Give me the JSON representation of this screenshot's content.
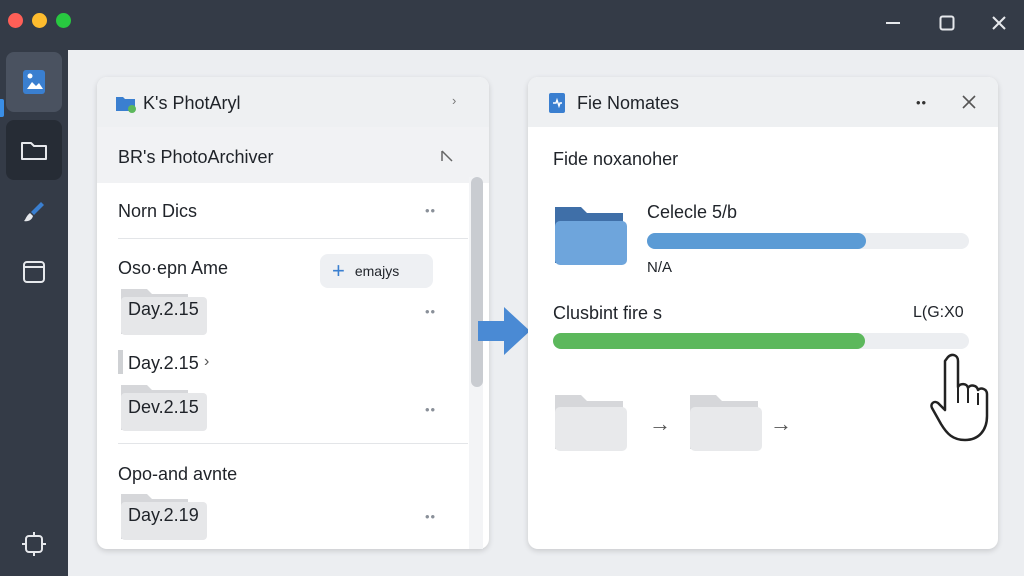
{
  "window": {
    "controls": [
      "close",
      "minimize",
      "zoom"
    ],
    "colors": {
      "close": "#ff5f57",
      "minimize": "#febc2e",
      "zoom": "#28c840"
    }
  },
  "sidebar": {
    "items": [
      {
        "icon": "photos-icon",
        "active": true
      },
      {
        "icon": "folder-icon",
        "selected": true
      },
      {
        "icon": "brush-icon"
      },
      {
        "icon": "window-icon"
      },
      {
        "icon": "sync-icon"
      }
    ]
  },
  "left_panel": {
    "title": "K's PhotAryl",
    "subtitle": "BR's PhotoArchiver",
    "sections": [
      {
        "title": "Norn Dics"
      },
      {
        "title": "Oso·epn Ame",
        "folders": [
          {
            "label": "Day.2.15"
          },
          {
            "label": "Day.2.15"
          },
          {
            "label": "Dev.2.15"
          }
        ]
      },
      {
        "title": "Opo-and avnte",
        "folders": [
          {
            "label": "Day.2.19"
          }
        ]
      }
    ],
    "action_button": {
      "icon": "plus-icon",
      "label": "emajys"
    }
  },
  "right_panel": {
    "title": "Fie Nomates",
    "subtitle": "Fide noxanoher",
    "progress1": {
      "label": "Celecle 5/b",
      "sublabel": "N/A",
      "value": 0.68,
      "color": "#5b9bd5"
    },
    "progress2": {
      "label": "Clusbint fire s",
      "right_label": "L(G:X0",
      "value": 0.75,
      "color": "#5cb85c"
    }
  },
  "transfer_arrow_color": "#4a8ad4"
}
